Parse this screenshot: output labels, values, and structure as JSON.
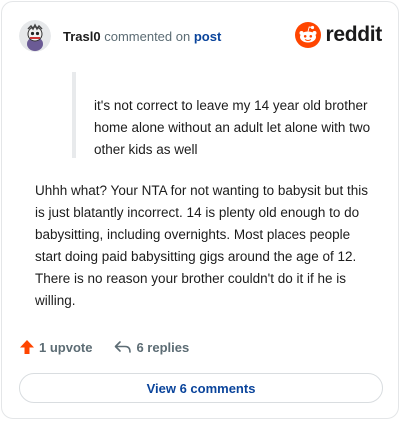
{
  "header": {
    "username": "Trasl0",
    "action_text": "commented on",
    "post_link": "post",
    "brand_text": "reddit",
    "avatar_icon": "snoo-avatar-icon",
    "brand_icon": "reddit-logo-icon"
  },
  "comment": {
    "quote": "it's not correct to leave my 14 year old brother home alone without an adult let alone with two other kids as well",
    "body": "Uhhh what? Your NTA for not wanting to babysit but this is just blatantly incorrect. 14 is plenty old enough to do babysitting, including overnights. Most places people start doing paid babysitting gigs around the age of 12. There is no reason your brother couldn't do it if he is willing."
  },
  "actions": {
    "upvote_label": "1 upvote",
    "replies_label": "6 replies",
    "upvote_icon": "upvote-arrow-icon",
    "reply_icon": "reply-arrow-icon"
  },
  "footer": {
    "view_comments_label": "View 6 comments"
  },
  "colors": {
    "brand_orange": "#ff4500",
    "link_blue": "#0a449b",
    "meta_gray": "#5c6c74"
  }
}
